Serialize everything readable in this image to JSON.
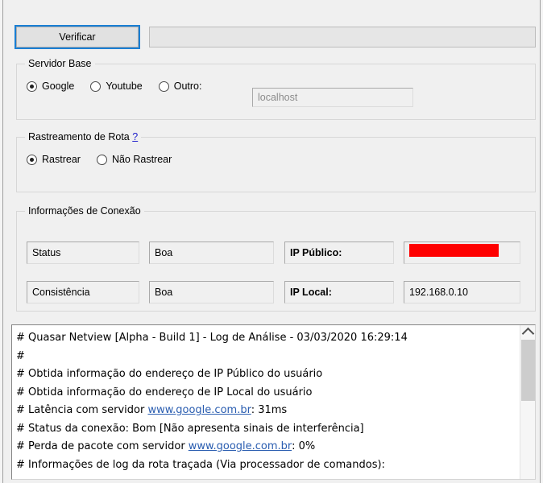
{
  "toolbar": {
    "verify_button": "Verificar",
    "progress_value": 0
  },
  "servidor_base": {
    "title": "Servidor Base",
    "options": [
      {
        "label": "Google",
        "checked": true
      },
      {
        "label": "Youtube",
        "checked": false
      },
      {
        "label": "Outro:",
        "checked": false
      }
    ],
    "outro_input_placeholder": "localhost",
    "outro_input_value": ""
  },
  "rastreamento": {
    "title": "Rastreamento de Rota",
    "help_link": "?",
    "options": [
      {
        "label": "Rastrear",
        "checked": true
      },
      {
        "label": "Não Rastrear",
        "checked": false
      }
    ]
  },
  "informacoes_conexao": {
    "title": "Informações de Conexão",
    "fields": [
      {
        "label": "Status",
        "value": "Boa"
      },
      {
        "label": "Consistência",
        "value": "Boa"
      },
      {
        "label": "IP Público:",
        "value": "",
        "redacted": true
      },
      {
        "label": "IP Local:",
        "value": "192.168.0.10",
        "redacted": false
      }
    ]
  },
  "log": {
    "lines": [
      {
        "text": "# Quasar Netview [Alpha - Build 1] - Log de Análise - 03/03/2020 16:29:14"
      },
      {
        "text": "#"
      },
      {
        "text": "# Obtida informação do endereço de IP Público do usuário"
      },
      {
        "text": "# Obtida informação do endereço de IP Local do usuário"
      },
      {
        "pre": "# Latência com servidor ",
        "link": "www.google.com.br",
        "post": ": 31ms"
      },
      {
        "text": "# Status da conexão: Bom [Não apresenta sinais de interferência]"
      },
      {
        "pre": "# Perda de pacote com servidor ",
        "link": "www.google.com.br",
        "post": ": 0%"
      },
      {
        "text": "# Informações de log da rota traçada (Via processador de comandos):"
      }
    ],
    "scroll_up_icon": "chevron-up-icon"
  },
  "colors": {
    "focus_blue": "#1a7fd4",
    "link_blue": "#2a5db0",
    "help_blue": "#2222cc",
    "redaction_red": "#fe0000",
    "window_bg": "#f0f0f0"
  }
}
